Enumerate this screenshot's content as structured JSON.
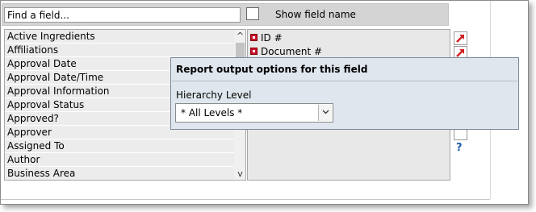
{
  "toolbar": {
    "find_placeholder": "Find a field...",
    "show_field_name_label": "Show field name"
  },
  "field_list": {
    "items": [
      "Active Ingredients",
      "Affiliations",
      "Approval Date",
      "Approval Date/Time",
      "Approval Information",
      "Approval Status",
      "Approved?",
      "Approver",
      "Assigned To",
      "Author",
      "Business Area"
    ],
    "scroll_up_glyph": "^",
    "scroll_down_glyph": "v"
  },
  "selected_fields": {
    "items": [
      "ID #",
      "Document #"
    ]
  },
  "side": {
    "help_glyph": "?"
  },
  "popup": {
    "title": "Report output options for this field",
    "hierarchy_label": "Hierarchy Level",
    "hierarchy_value": "* All Levels *"
  },
  "colors": {
    "remove_icon": "#c8102e",
    "move_arrow": "#d02020",
    "help": "#1b5fa8",
    "popup_bg": "#dfe6ee"
  }
}
